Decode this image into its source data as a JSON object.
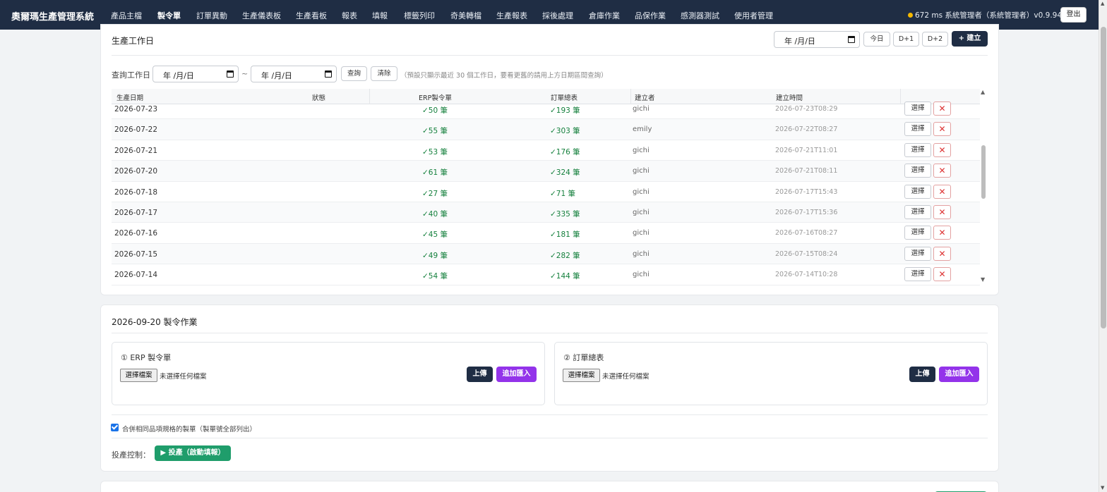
{
  "app": {
    "title": "奧爾瑪生產管理系統"
  },
  "nav": {
    "items": [
      {
        "label": "產品主檔",
        "active": false
      },
      {
        "label": "製令單",
        "active": true
      },
      {
        "label": "訂單異動",
        "active": false
      },
      {
        "label": "生產儀表板",
        "active": false
      },
      {
        "label": "生產看板",
        "active": false
      },
      {
        "label": "報表",
        "active": false
      },
      {
        "label": "填報",
        "active": false
      },
      {
        "label": "標籤列印",
        "active": false
      },
      {
        "label": "奇美轉檔",
        "active": false
      },
      {
        "label": "生產報表",
        "active": false
      },
      {
        "label": "採後處理",
        "active": false
      },
      {
        "label": "倉庫作業",
        "active": false
      },
      {
        "label": "品保作業",
        "active": false
      },
      {
        "label": "感測器測試",
        "active": false
      },
      {
        "label": "使用者管理",
        "active": false
      }
    ],
    "status_text": "672 ms  系統管理者（系統管理者）v0.9.94",
    "status_color": "#f5b800",
    "logout_label": "登出"
  },
  "workdays": {
    "title": "生產工作日",
    "date_value": "年 /月/日",
    "today_label": "今日",
    "d1_label": "D+1",
    "d2_label": "D+2",
    "create_label": "+ 建立",
    "query_label": "查詢工作日",
    "from_value": "年 /月/日",
    "range_sep": "~",
    "to_value": "年 /月/日",
    "search_label": "查詢",
    "clear_label": "清除",
    "hint": "（預設只顯示最近 30 個工作日，要看更舊的請用上方日期區間查詢）",
    "columns": [
      "生產日期",
      "狀態",
      "ERP製令單",
      "訂單總表",
      "建立者",
      "建立時間"
    ],
    "rows": [
      {
        "date": "2026-07-23",
        "erp": "✓50 筆",
        "orders": "✓193 筆",
        "creator": "gichi",
        "created": "2026-07-23T08:29"
      },
      {
        "date": "2026-07-22",
        "erp": "✓55 筆",
        "orders": "✓303 筆",
        "creator": "emily",
        "created": "2026-07-22T08:27"
      },
      {
        "date": "2026-07-21",
        "erp": "✓53 筆",
        "orders": "✓176 筆",
        "creator": "gichi",
        "created": "2026-07-21T11:01"
      },
      {
        "date": "2026-07-20",
        "erp": "✓61 筆",
        "orders": "✓324 筆",
        "creator": "gichi",
        "created": "2026-07-21T08:11"
      },
      {
        "date": "2026-07-18",
        "erp": "✓27 筆",
        "orders": "✓71 筆",
        "creator": "gichi",
        "created": "2026-07-17T15:43"
      },
      {
        "date": "2026-07-17",
        "erp": "✓40 筆",
        "orders": "✓335 筆",
        "creator": "gichi",
        "created": "2026-07-17T15:36"
      },
      {
        "date": "2026-07-16",
        "erp": "✓45 筆",
        "orders": "✓181 筆",
        "creator": "gichi",
        "created": "2026-07-16T08:27"
      },
      {
        "date": "2026-07-15",
        "erp": "✓49 筆",
        "orders": "✓282 筆",
        "creator": "gichi",
        "created": "2026-07-15T08:24"
      },
      {
        "date": "2026-07-14",
        "erp": "✓54 筆",
        "orders": "✓144 筆",
        "creator": "gichi",
        "created": "2026-07-14T10:28"
      }
    ],
    "select_label": "選擇",
    "delete_glyph": "✕"
  },
  "ops": {
    "title": "2026-09-20 製令作業",
    "erp_box": {
      "title": "① ERP 製令單",
      "file_button": "選擇檔案",
      "file_status": "未選擇任何檔案",
      "upload_label": "上傳",
      "append_label": "追加匯入"
    },
    "order_box": {
      "title": "② 訂單總表",
      "file_button": "選擇檔案",
      "file_status": "未選擇任何檔案",
      "upload_label": "上傳",
      "append_label": "追加匯入"
    },
    "merge_checked": true,
    "merge_label": "合併相同品項規格的製單（製單號全部列出）",
    "control_label": "投產控制：",
    "start_label": "▶ 投產（啟動填報）"
  },
  "colors": {
    "nav_bg": "#1f2d44",
    "accent_green": "#1f9d6b",
    "accent_purple": "#9333ea",
    "ok_green": "#15803d",
    "danger": "#dd3333"
  }
}
